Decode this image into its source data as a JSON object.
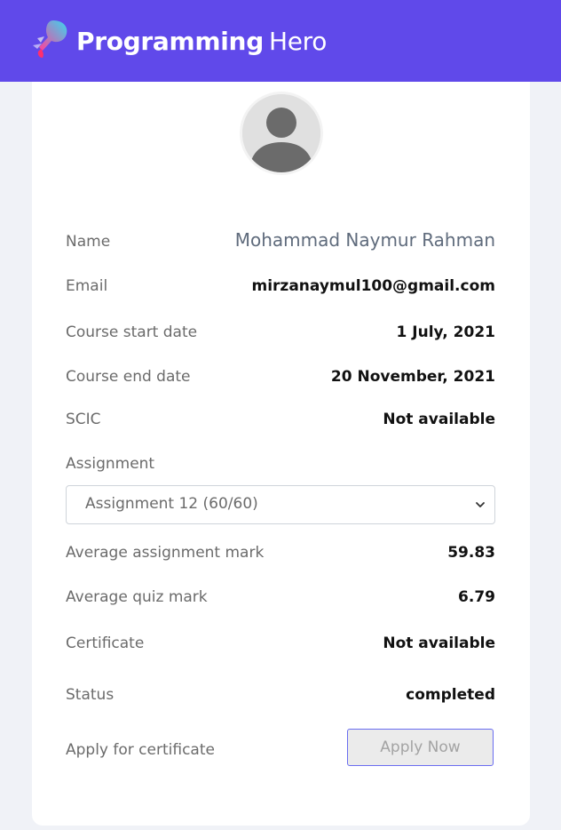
{
  "header": {
    "brand_bold": "Programming",
    "brand_light": "Hero",
    "logo_icon": "rocket-logo-icon",
    "background": "#6049ea"
  },
  "profile": {
    "avatar_icon": "user-avatar-icon",
    "name_label": "Name",
    "name_value": "Mohammad Naymur Rahman",
    "email_label": "Email",
    "email_value": "mirzanaymul100@gmail.com",
    "start_label": "Course start date",
    "start_value": "1 July, 2021",
    "end_label": "Course end date",
    "end_value": "20 November, 2021",
    "scic_label": "SCIC",
    "scic_value": "Not available",
    "assignment_label": "Assignment",
    "assignment_selected": "Assignment 12 (60/60)",
    "avg_assignment_label": "Average assignment mark",
    "avg_assignment_value": "59.83",
    "avg_quiz_label": "Average quiz mark",
    "avg_quiz_value": "6.79",
    "certificate_label": "Certificate",
    "certificate_value": "Not available",
    "status_label": "Status",
    "status_value": "completed",
    "apply_label": "Apply for certificate",
    "apply_button": "Apply Now"
  },
  "colors": {
    "accent": "#6049ea",
    "button_border": "#6a6df0"
  }
}
